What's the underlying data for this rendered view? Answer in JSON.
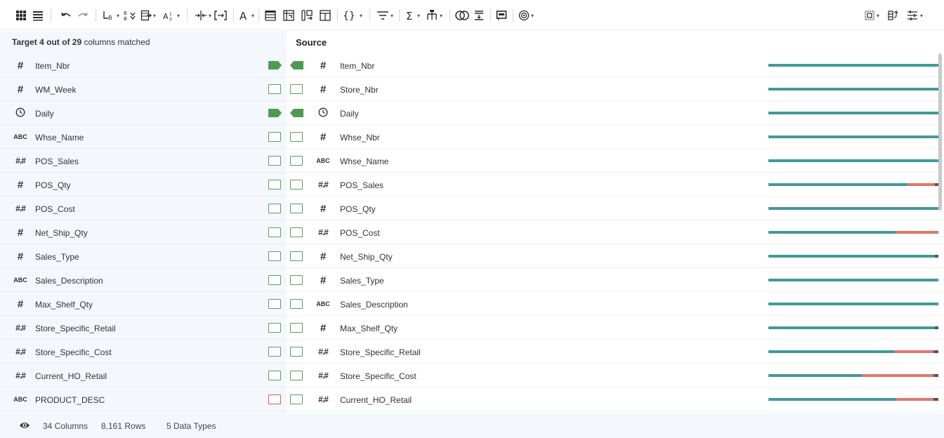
{
  "toolbar": {
    "items": [
      "grid-view-icon",
      "list-view-icon",
      "undo-icon",
      "redo-icon",
      "rename-icon",
      "sort-icon",
      "insert-column-icon",
      "type-icon",
      "split-icon",
      "merge-icon",
      "text-case-icon",
      "header-icon",
      "pivot-icon",
      "unpivot-icon",
      "transpose-icon",
      "json-icon",
      "filter-icon",
      "sum-icon",
      "hierarchy-icon",
      "join-icon",
      "reorder-icon",
      "comment-icon",
      "target-icon",
      "profile-icon",
      "schema-icon",
      "settings-icon"
    ]
  },
  "header": {
    "target_label": "Target",
    "matched_count": "4 out of 29",
    "matched_suffix": "columns matched",
    "source_label": "Source"
  },
  "target_rows": [
    {
      "type": "#",
      "name": "Item_Nbr",
      "match": "matched"
    },
    {
      "type": "#",
      "name": "WM_Week",
      "match": "empty"
    },
    {
      "type": "clock",
      "name": "Daily",
      "match": "matched"
    },
    {
      "type": "ABC",
      "name": "Whse_Name",
      "match": "empty"
    },
    {
      "type": "#.#",
      "name": "POS_Sales",
      "match": "empty"
    },
    {
      "type": "#",
      "name": "POS_Qty",
      "match": "empty"
    },
    {
      "type": "#.#",
      "name": "POS_Cost",
      "match": "empty"
    },
    {
      "type": "#",
      "name": "Net_Ship_Qty",
      "match": "empty"
    },
    {
      "type": "#",
      "name": "Sales_Type",
      "match": "empty"
    },
    {
      "type": "ABC",
      "name": "Sales_Description",
      "match": "empty"
    },
    {
      "type": "#",
      "name": "Max_Shelf_Qty",
      "match": "empty"
    },
    {
      "type": "#.#",
      "name": "Store_Specific_Retail",
      "match": "empty"
    },
    {
      "type": "#.#",
      "name": "Store_Specific_Cost",
      "match": "empty"
    },
    {
      "type": "#.#",
      "name": "Current_HO_Retail",
      "match": "empty"
    },
    {
      "type": "ABC",
      "name": "PRODUCT_DESC",
      "match": "error"
    }
  ],
  "source_rows": [
    {
      "type": "#",
      "name": "Item_Nbr",
      "match": "matched",
      "ok": 1.0,
      "bad": 0.0,
      "nulls": 0.0
    },
    {
      "type": "#",
      "name": "Store_Nbr",
      "match": "empty",
      "ok": 1.0,
      "bad": 0.0,
      "nulls": 0.0
    },
    {
      "type": "clock",
      "name": "Daily",
      "match": "matched",
      "ok": 1.0,
      "bad": 0.0,
      "nulls": 0.0
    },
    {
      "type": "#",
      "name": "Whse_Nbr",
      "match": "empty",
      "ok": 1.0,
      "bad": 0.0,
      "nulls": 0.0
    },
    {
      "type": "ABC",
      "name": "Whse_Name",
      "match": "empty",
      "ok": 1.0,
      "bad": 0.0,
      "nulls": 0.0
    },
    {
      "type": "#.#",
      "name": "POS_Sales",
      "match": "empty",
      "ok": 0.82,
      "bad": 0.16,
      "nulls": 0.02
    },
    {
      "type": "#",
      "name": "POS_Qty",
      "match": "empty",
      "ok": 1.0,
      "bad": 0.0,
      "nulls": 0.0
    },
    {
      "type": "#.#",
      "name": "POS_Cost",
      "match": "empty",
      "ok": 0.75,
      "bad": 0.25,
      "nulls": 0.0
    },
    {
      "type": "#",
      "name": "Net_Ship_Qty",
      "match": "empty",
      "ok": 0.98,
      "bad": 0.0,
      "nulls": 0.02
    },
    {
      "type": "#",
      "name": "Sales_Type",
      "match": "empty",
      "ok": 1.0,
      "bad": 0.0,
      "nulls": 0.0
    },
    {
      "type": "ABC",
      "name": "Sales_Description",
      "match": "empty",
      "ok": 1.0,
      "bad": 0.0,
      "nulls": 0.0
    },
    {
      "type": "#",
      "name": "Max_Shelf_Qty",
      "match": "empty",
      "ok": 0.98,
      "bad": 0.0,
      "nulls": 0.02
    },
    {
      "type": "#.#",
      "name": "Store_Specific_Retail",
      "match": "empty",
      "ok": 0.74,
      "bad": 0.23,
      "nulls": 0.03
    },
    {
      "type": "#.#",
      "name": "Store_Specific_Cost",
      "match": "empty",
      "ok": 0.55,
      "bad": 0.42,
      "nulls": 0.03
    },
    {
      "type": "#.#",
      "name": "Current_HO_Retail",
      "match": "empty",
      "ok": 0.75,
      "bad": 0.22,
      "nulls": 0.03
    }
  ],
  "colors": {
    "valid": "#419a9a",
    "mismatch": "#e2766e",
    "null": "#555555",
    "matched": "#4e9a52",
    "error": "#e05a4f"
  },
  "footer": {
    "columns": "34 Columns",
    "rows": "8,161 Rows",
    "types": "5 Data Types"
  }
}
